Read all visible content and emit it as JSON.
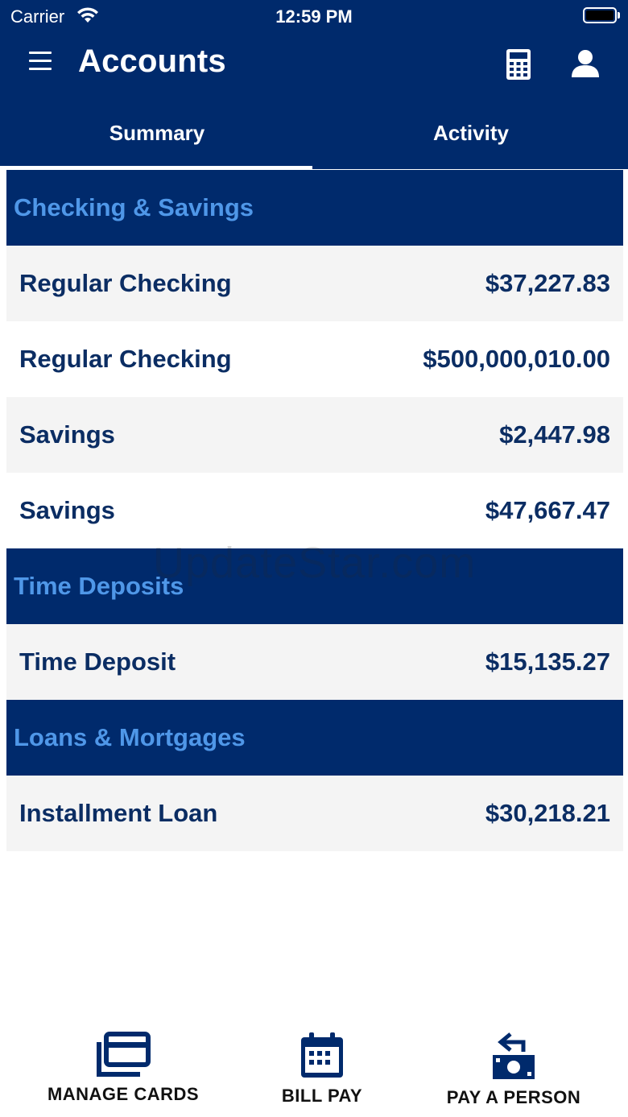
{
  "status_bar": {
    "carrier": "Carrier",
    "time": "12:59 PM"
  },
  "header": {
    "title": "Accounts",
    "icons": [
      "menu-icon",
      "calculator-icon",
      "profile-icon"
    ]
  },
  "tabs": [
    {
      "label": "Summary",
      "selected": true
    },
    {
      "label": "Activity",
      "selected": false
    }
  ],
  "sections": [
    {
      "title": "Checking & Savings",
      "accounts": [
        {
          "name": "Regular Checking",
          "balance": "$37,227.83"
        },
        {
          "name": "Regular Checking",
          "balance": "$500,000,010.00"
        },
        {
          "name": "Savings",
          "balance": "$2,447.98"
        },
        {
          "name": "Savings",
          "balance": "$47,667.47"
        }
      ]
    },
    {
      "title": "Time Deposits",
      "accounts": [
        {
          "name": "Time Deposit",
          "balance": "$15,135.27"
        }
      ]
    },
    {
      "title": "Loans & Mortgages",
      "accounts": [
        {
          "name": "Installment Loan",
          "balance": "$30,218.21"
        }
      ]
    }
  ],
  "watermark": "UpdateStar.com",
  "bottom_nav": [
    {
      "label": "MANAGE CARDS",
      "icon": "cards-icon"
    },
    {
      "label": "BILL PAY",
      "icon": "calendar-icon"
    },
    {
      "label": "PAY A PERSON",
      "icon": "money-transfer-icon"
    }
  ],
  "colors": {
    "primary": "#002a6c",
    "section_text": "#4f97e8",
    "row_text": "#0b2d63",
    "row_alt_bg": "#f4f4f4"
  }
}
